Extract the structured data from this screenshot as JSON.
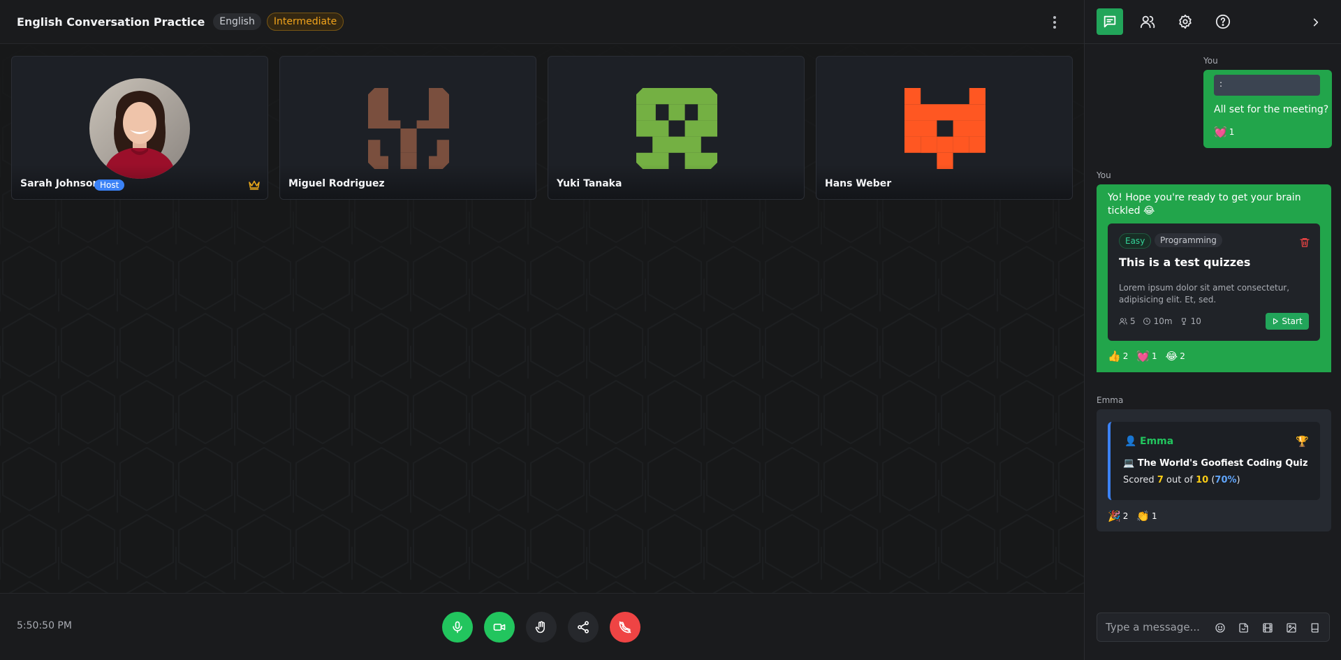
{
  "header": {
    "title": "English Conversation Practice",
    "language": "English",
    "level": "Intermediate"
  },
  "participants": [
    {
      "name": "Sarah Johnson",
      "badge": "Host",
      "avatar": "photo",
      "color": "#b2112e"
    },
    {
      "name": "Miguel Rodriguez",
      "avatar": "identicon",
      "color": "#7a4f3e"
    },
    {
      "name": "Yuki Tanaka",
      "avatar": "identicon",
      "color": "#74b043"
    },
    {
      "name": "Hans Weber",
      "avatar": "identicon",
      "color": "#ff5722"
    }
  ],
  "footer": {
    "time": "5:50:50 PM",
    "controls": [
      "mic-icon",
      "video-icon",
      "hand-icon",
      "share-icon",
      "end-call-icon"
    ]
  },
  "sidebar": {
    "tabs": [
      "chat-icon",
      "users-icon",
      "gear-icon",
      "help-icon"
    ],
    "messages": [
      {
        "sender": "You",
        "reply_text": ":",
        "text": "All set for the meeting?",
        "reactions": [
          {
            "emoji": "💓",
            "count": "1"
          }
        ]
      },
      {
        "sender": "You",
        "text": "Yo! Hope you're ready to get your brain tickled 😂",
        "quiz": {
          "difficulty": "Easy",
          "category": "Programming",
          "title": "This is a test quizzes",
          "description": "Lorem ipsum dolor sit amet consectetur, adipisicing elit. Et, sed.",
          "participants": "5",
          "duration": "10m",
          "questions": "10",
          "start_label": "Start"
        },
        "reactions": [
          {
            "emoji": "👍",
            "count": "2"
          },
          {
            "emoji": "💓",
            "count": "1"
          },
          {
            "emoji": "😂",
            "count": "2"
          }
        ]
      },
      {
        "sender": "Emma",
        "result": {
          "user_icon": "👤",
          "user": "Emma",
          "trophy": "🏆",
          "quiz_icon": "💻",
          "quiz_title": "The World's Goofiest Coding Quiz",
          "scored_label": "Scored",
          "score": "7",
          "out_of_label": "out of",
          "total": "10",
          "percent": "70%"
        },
        "reactions": [
          {
            "emoji": "🎉",
            "count": "2"
          },
          {
            "emoji": "👏",
            "count": "1"
          }
        ]
      }
    ],
    "composer": {
      "placeholder": "Type a message...",
      "icons": [
        "emoji-icon",
        "sticker-icon",
        "gif-icon",
        "image-icon",
        "book-icon"
      ]
    }
  }
}
